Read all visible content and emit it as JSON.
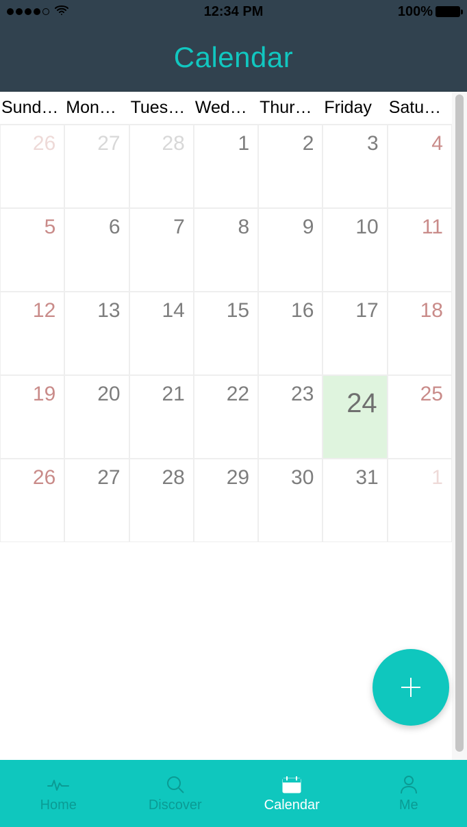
{
  "status": {
    "time": "12:34 PM",
    "battery": "100%"
  },
  "header": {
    "title": "Calendar"
  },
  "weekdays": [
    "Sund…",
    "Mon…",
    "Tues…",
    "Wed…",
    "Thur…",
    "Friday",
    "Satu…"
  ],
  "grid": [
    [
      {
        "n": "26",
        "cls": "weekend out"
      },
      {
        "n": "27",
        "cls": "out"
      },
      {
        "n": "28",
        "cls": "out"
      },
      {
        "n": "1",
        "cls": ""
      },
      {
        "n": "2",
        "cls": ""
      },
      {
        "n": "3",
        "cls": ""
      },
      {
        "n": "4",
        "cls": "weekend"
      }
    ],
    [
      {
        "n": "5",
        "cls": "weekend"
      },
      {
        "n": "6",
        "cls": ""
      },
      {
        "n": "7",
        "cls": ""
      },
      {
        "n": "8",
        "cls": ""
      },
      {
        "n": "9",
        "cls": ""
      },
      {
        "n": "10",
        "cls": ""
      },
      {
        "n": "11",
        "cls": "weekend"
      }
    ],
    [
      {
        "n": "12",
        "cls": "weekend"
      },
      {
        "n": "13",
        "cls": ""
      },
      {
        "n": "14",
        "cls": ""
      },
      {
        "n": "15",
        "cls": ""
      },
      {
        "n": "16",
        "cls": ""
      },
      {
        "n": "17",
        "cls": ""
      },
      {
        "n": "18",
        "cls": "weekend"
      }
    ],
    [
      {
        "n": "19",
        "cls": "weekend"
      },
      {
        "n": "20",
        "cls": ""
      },
      {
        "n": "21",
        "cls": ""
      },
      {
        "n": "22",
        "cls": ""
      },
      {
        "n": "23",
        "cls": ""
      },
      {
        "n": "24",
        "cls": "today"
      },
      {
        "n": "25",
        "cls": "weekend"
      }
    ],
    [
      {
        "n": "26",
        "cls": "weekend"
      },
      {
        "n": "27",
        "cls": ""
      },
      {
        "n": "28",
        "cls": ""
      },
      {
        "n": "29",
        "cls": ""
      },
      {
        "n": "30",
        "cls": ""
      },
      {
        "n": "31",
        "cls": ""
      },
      {
        "n": "1",
        "cls": "weekend out"
      }
    ]
  ],
  "nav": {
    "items": [
      {
        "label": "Home",
        "icon": "pulse"
      },
      {
        "label": "Discover",
        "icon": "search"
      },
      {
        "label": "Calendar",
        "icon": "calendar",
        "active": true
      },
      {
        "label": "Me",
        "icon": "person"
      }
    ]
  },
  "fab": {
    "icon": "plus"
  }
}
